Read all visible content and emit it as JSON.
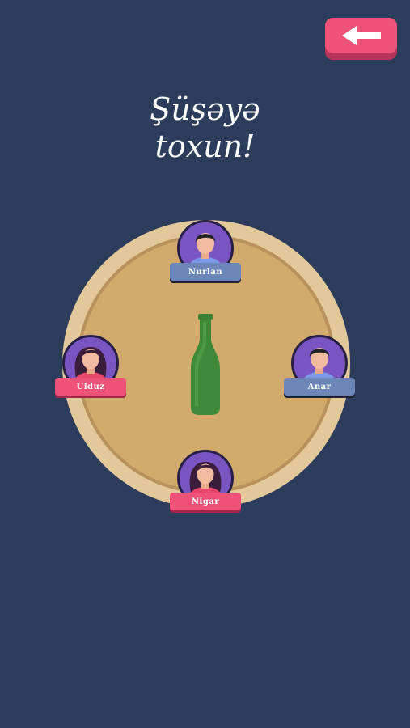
{
  "header": {
    "back_icon": "arrow-left-icon",
    "accent_color": "#ef5279"
  },
  "title": {
    "line1": "Şüşəyə",
    "line2": "toxun!"
  },
  "game": {
    "center_object": "bottle-icon",
    "players": [
      {
        "name": "Nurlan",
        "gender": "male",
        "plate_color": "#6c86b7"
      },
      {
        "name": "Ulduz",
        "gender": "female",
        "plate_color": "#ef5279"
      },
      {
        "name": "Anar",
        "gender": "male",
        "plate_color": "#6c86b7"
      },
      {
        "name": "Nigar",
        "gender": "female",
        "plate_color": "#ef5279"
      }
    ]
  }
}
